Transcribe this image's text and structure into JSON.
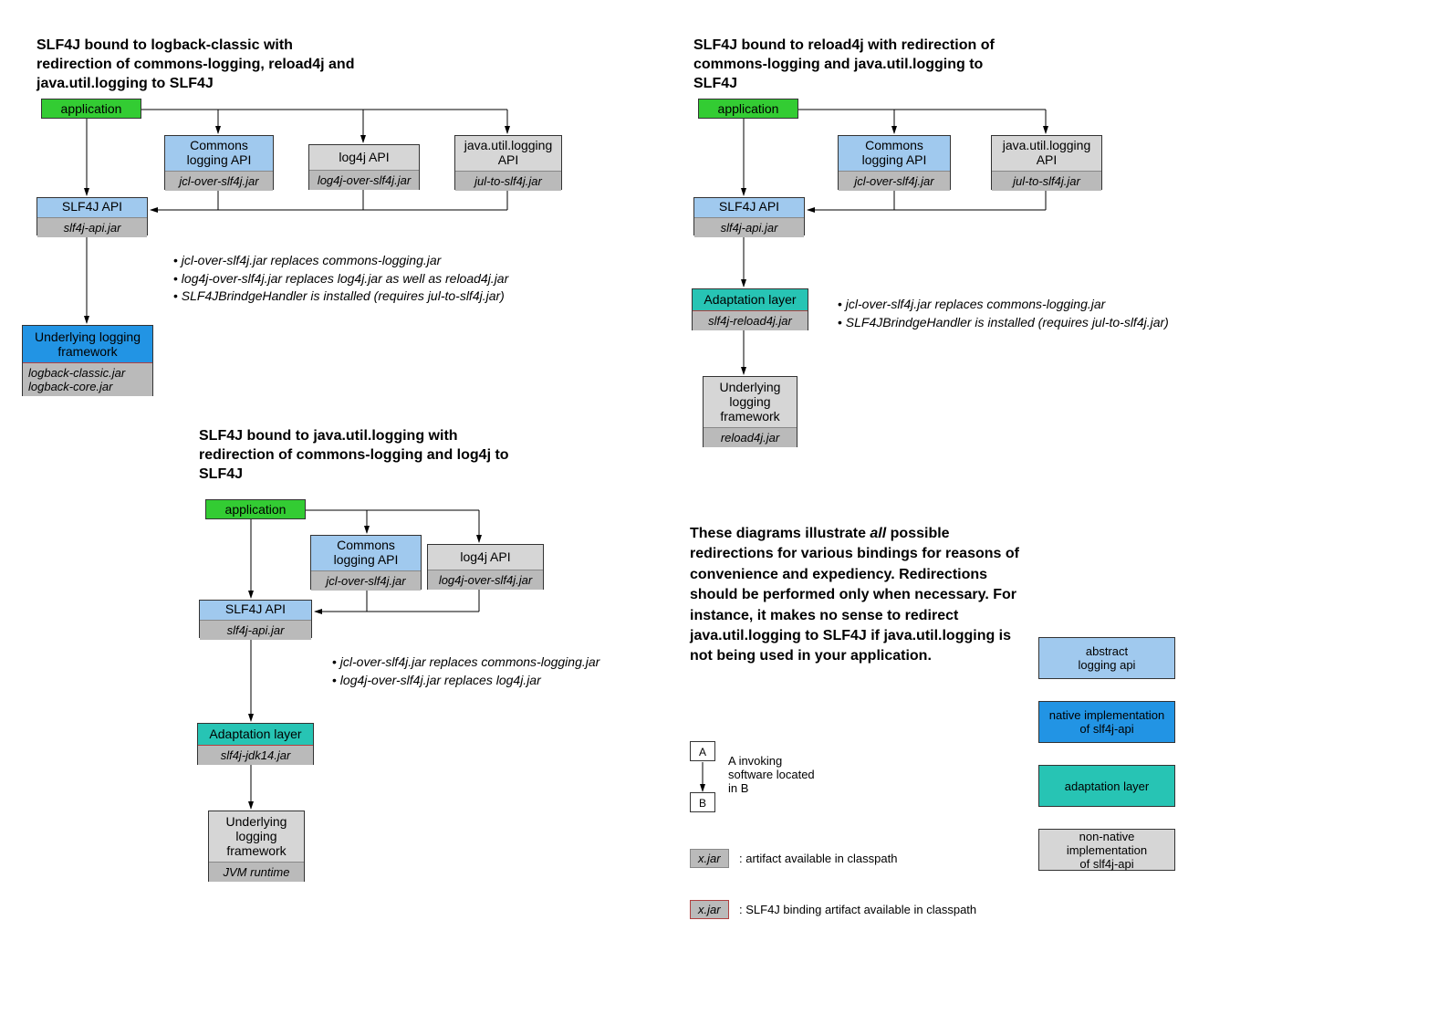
{
  "diagram1": {
    "title": "SLF4J bound to logback-classic with redirection of commons-logging, reload4j and java.util.logging to SLF4J",
    "application": "application",
    "commons": {
      "label": "Commons\nlogging API",
      "jar": "jcl-over-slf4j.jar"
    },
    "log4j": {
      "label": "log4j API",
      "jar": "log4j-over-slf4j.jar"
    },
    "jul": {
      "label": "java.util.logging\nAPI",
      "jar": "jul-to-slf4j.jar"
    },
    "slf4j": {
      "label": "SLF4J API",
      "jar": "slf4j-api.jar"
    },
    "underlying": {
      "label": "Underlying logging\nframework",
      "jar": "logback-classic.jar\nlogback-core.jar"
    },
    "bullets": [
      "jcl-over-slf4j.jar replaces commons-logging.jar",
      "log4j-over-slf4j.jar replaces log4j.jar as well as reload4j.jar",
      "SLF4JBrindgeHandler is installed (requires jul-to-slf4j.jar)"
    ]
  },
  "diagram2": {
    "title": "SLF4J bound to reload4j with redirection of commons-logging and java.util.logging to SLF4J",
    "application": "application",
    "commons": {
      "label": "Commons\nlogging API",
      "jar": "jcl-over-slf4j.jar"
    },
    "jul": {
      "label": "java.util.logging\nAPI",
      "jar": "jul-to-slf4j.jar"
    },
    "slf4j": {
      "label": "SLF4J API",
      "jar": "slf4j-api.jar"
    },
    "adapt": {
      "label": "Adaptation layer",
      "jar": "slf4j-reload4j.jar"
    },
    "underlying": {
      "label": "Underlying\nlogging\nframework",
      "jar": "reload4j.jar"
    },
    "bullets": [
      "jcl-over-slf4j.jar replaces commons-logging.jar",
      "SLF4JBrindgeHandler is installed (requires jul-to-slf4j.jar)"
    ]
  },
  "diagram3": {
    "title": "SLF4J bound to java.util.logging with redirection of commons-logging and log4j to SLF4J",
    "application": "application",
    "commons": {
      "label": "Commons\nlogging API",
      "jar": "jcl-over-slf4j.jar"
    },
    "log4j": {
      "label": "log4j API",
      "jar": "log4j-over-slf4j.jar"
    },
    "slf4j": {
      "label": "SLF4J API",
      "jar": "slf4j-api.jar"
    },
    "adapt": {
      "label": "Adaptation layer",
      "jar": "slf4j-jdk14.jar"
    },
    "underlying": {
      "label": "Underlying\nlogging\nframework",
      "jar": "JVM runtime"
    },
    "bullets": [
      "jcl-over-slf4j.jar replaces commons-logging.jar",
      "log4j-over-slf4j.jar replaces log4j.jar"
    ]
  },
  "explanation": "These diagrams illustrate all possible redirections for various bindings for reasons of convenience and expediency. Redirections should be performed only when necessary. For instance, it makes no sense to redirect java.util.logging to SLF4J if java.util.logging is not being used in your application.",
  "legend": {
    "ab": {
      "A": "A",
      "B": "B",
      "text": "A invoking\nsoftware located\nin B"
    },
    "jar_plain": {
      "label": "x.jar",
      "text": ": artifact available in classpath"
    },
    "jar_red": {
      "label": "x.jar",
      "text": ": SLF4J binding artifact available in classpath"
    },
    "abstract_api": "abstract\nlogging api",
    "native_impl": "native implementation\nof slf4j-api",
    "adapt_layer": "adaptation layer",
    "nonnative": "non-native implementation\nof slf4j-api"
  }
}
